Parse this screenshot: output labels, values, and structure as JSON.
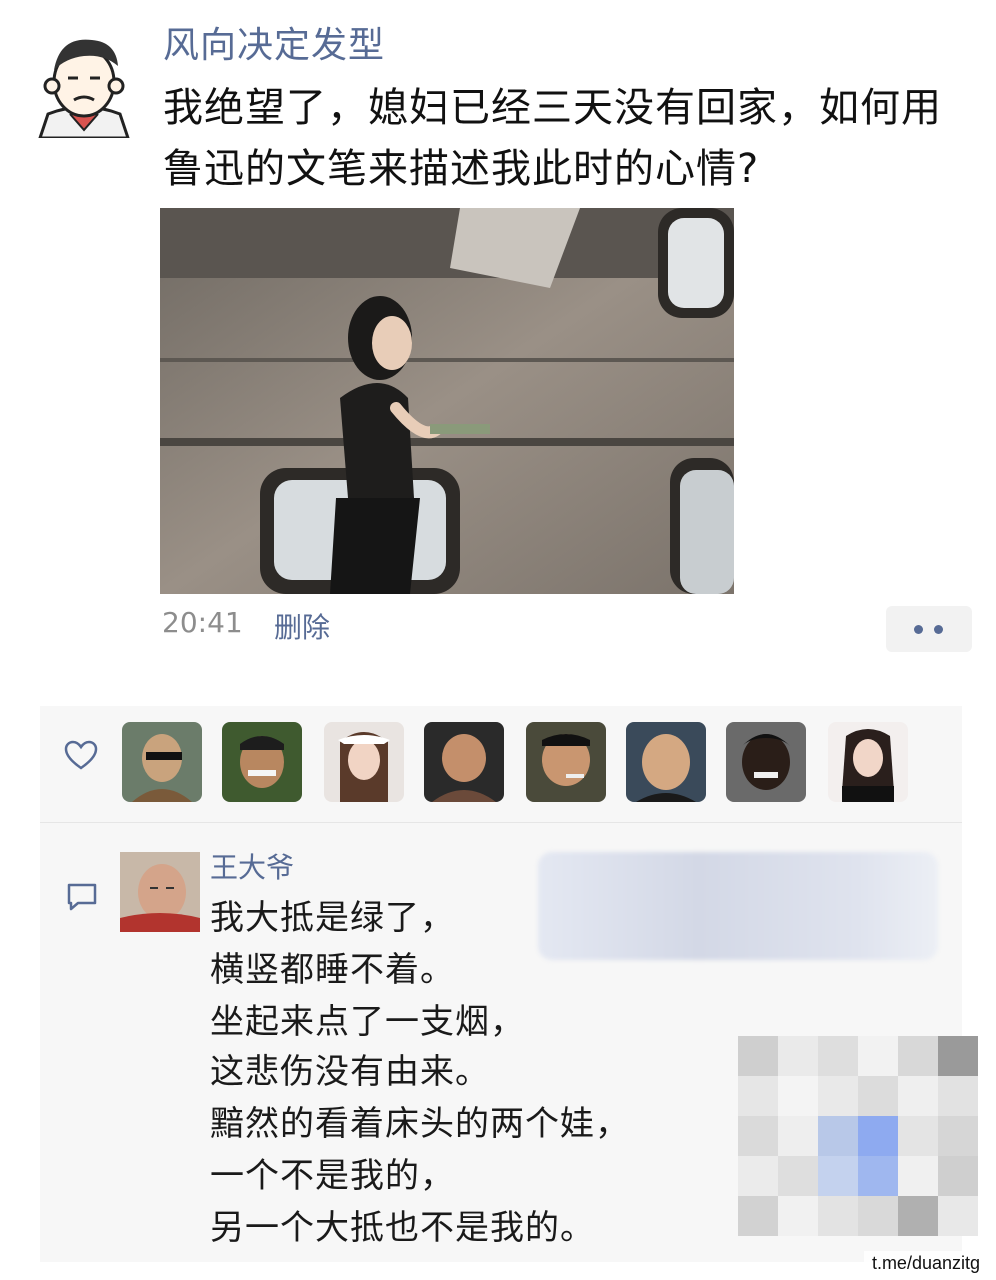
{
  "post": {
    "username": "风向决定发型",
    "text_lines": [
      "我绝望了，媳妇已经三天没有回家，如何用",
      "鲁迅的文笔来描述我此时的心情?"
    ],
    "time": "20:41",
    "delete_label": "删除"
  },
  "likes": {
    "count_shown": 8
  },
  "comment": {
    "author": "王大爷",
    "lines": [
      "我大抵是绿了，",
      "横竖都睡不着。",
      "坐起来点了一支烟，",
      "这悲伤没有由来。",
      "黯然的看着床头的两个娃，",
      "一个不是我的，",
      "另一个大抵也不是我的。"
    ]
  },
  "watermark": "t.me/duanzitg",
  "colors": {
    "link_blue": "#576b95",
    "text": "#1a1a1a",
    "meta_gray": "#8d8d8d",
    "panel_bg": "#f7f7f7"
  },
  "icons": {
    "heart": "heart-icon",
    "comment": "comment-icon",
    "more": "more-dots-icon"
  }
}
